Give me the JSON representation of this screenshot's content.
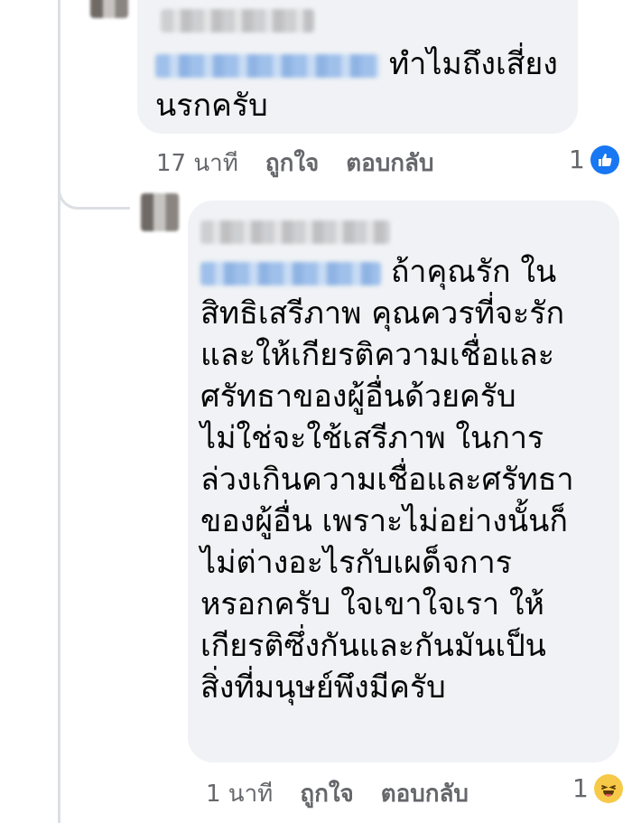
{
  "comments": [
    {
      "text_after_mention": "ทำไมถึงเสี่ยง",
      "text_rest": "นรกครับ",
      "time": "17 นาที",
      "like_label": "ถูกใจ",
      "reply_label": "ตอบกลับ",
      "reaction_count": "1",
      "reaction_icon": "like-icon"
    },
    {
      "text_after_mention": "ถ้าคุณรัก ใน",
      "text_rest": "สิทธิเสรีภาพ คุณควรที่จะรัก\nและให้เกียรติความเชื่อและ\nศรัทธาของผู้อื่นด้วยครับ\nไม่ใช่จะใช้เสรีภาพ ในการ\nล่วงเกินความเชื่อและศรัทธา\nของผู้อื่น เพราะไม่อย่างนั้นก็\nไม่ต่างอะไรกับเผด็จการ\nหรอกครับ ใจเขาใจเรา ให้\nเกียรติซึ่งกันและกันมันเป็น\nสิ่งที่มนุษย์พึงมีครับ",
      "time": "1 นาที",
      "like_label": "ถูกใจ",
      "reply_label": "ตอบกลับ",
      "reaction_count": "1",
      "reaction_icon": "haha-icon"
    }
  ],
  "colors": {
    "bubble": "#f0f2f5",
    "meta_text": "#65676b",
    "like_blue": "#1877f2",
    "haha_yellow": "#f7c948"
  }
}
